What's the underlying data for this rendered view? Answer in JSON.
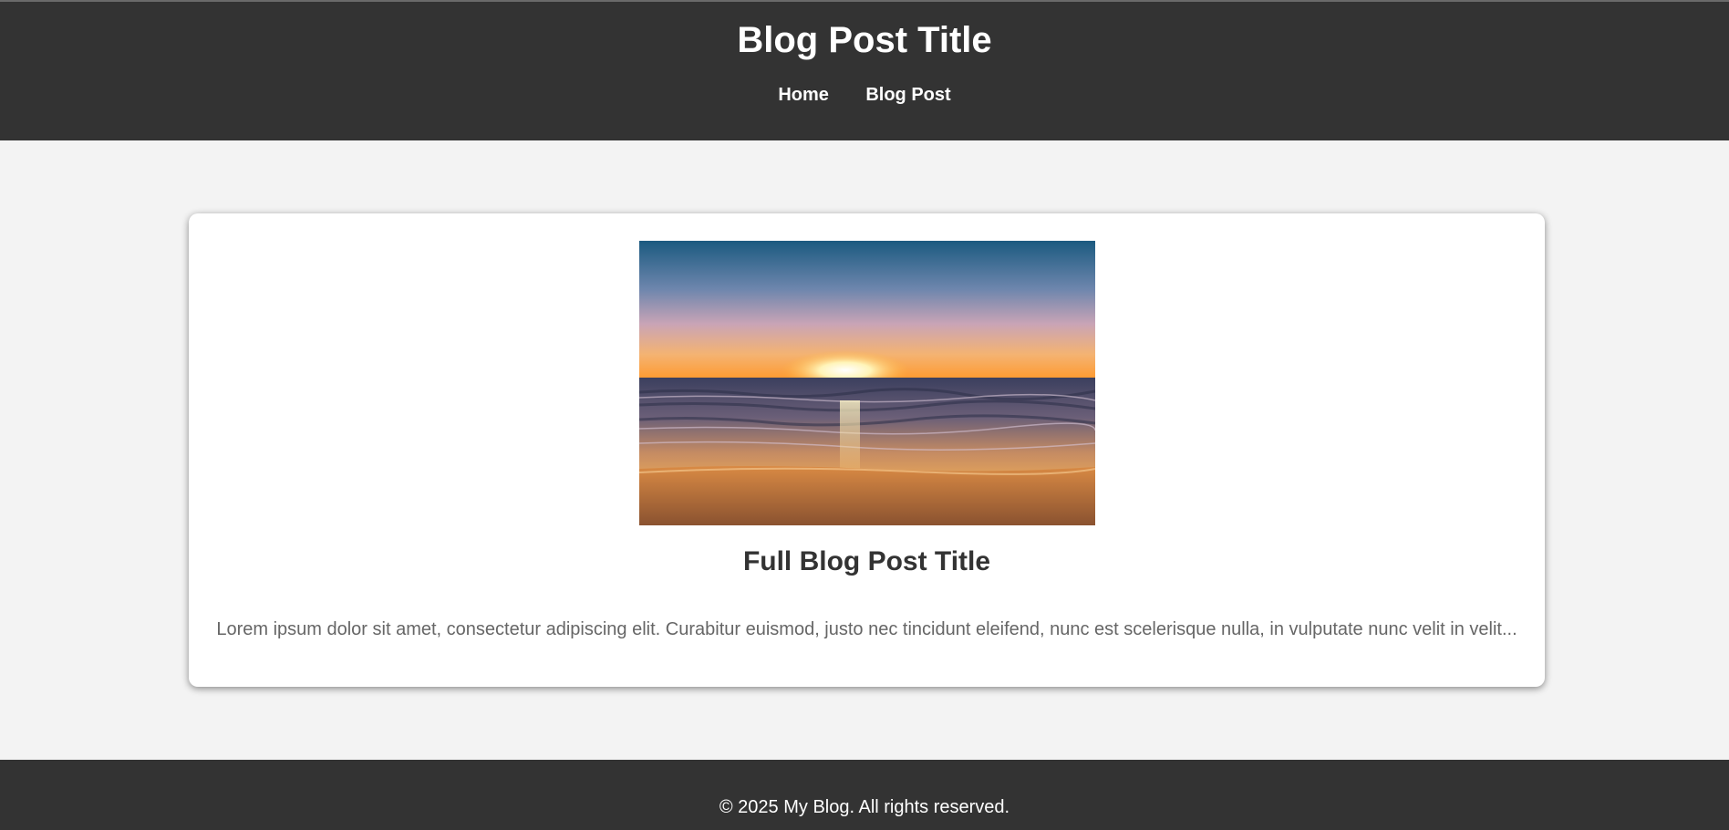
{
  "header": {
    "title": "Blog Post Title",
    "nav": [
      {
        "label": "Home"
      },
      {
        "label": "Blog Post"
      }
    ]
  },
  "post": {
    "image_subject": "sunset-over-beach",
    "title": "Full Blog Post Title",
    "excerpt": "Lorem ipsum dolor sit amet, consectetur adipiscing elit. Curabitur euismod, justo nec tincidunt eleifend, nunc est scelerisque nulla, in vulputate nunc velit in velit..."
  },
  "footer": {
    "copyright": "© 2025 My Blog. All rights reserved."
  },
  "colors": {
    "header_bg": "#333333",
    "page_bg": "#f3f3f3",
    "card_bg": "#ffffff",
    "title_text": "#333333",
    "body_text": "#666666"
  }
}
